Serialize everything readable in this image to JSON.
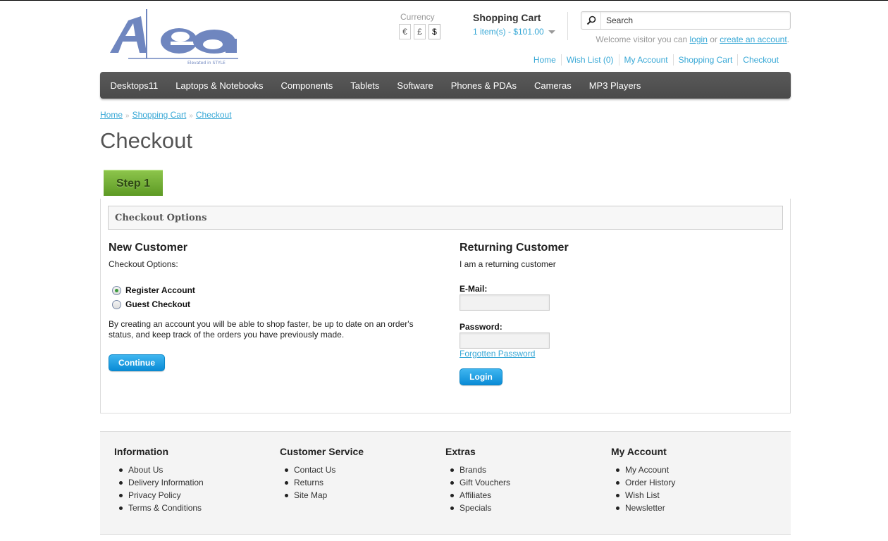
{
  "logo": {
    "letters": "Aea",
    "tagline": "Elevated in STYLE"
  },
  "currency": {
    "label": "Currency",
    "options": [
      "€",
      "£",
      "$"
    ],
    "selected": "$"
  },
  "cart": {
    "title": "Shopping Cart",
    "summary": "1 item(s) - $101.00"
  },
  "search": {
    "placeholder": "Search"
  },
  "welcome": {
    "prefix": "Welcome visitor you can ",
    "login": "login",
    "middle": " or ",
    "create": "create an account",
    "suffix": "."
  },
  "toplinks": [
    "Home",
    "Wish List (0)",
    "My Account",
    "Shopping Cart",
    "Checkout"
  ],
  "menu": [
    "Desktops11",
    "Laptops & Notebooks",
    "Components",
    "Tablets",
    "Software",
    "Phones & PDAs",
    "Cameras",
    "MP3 Players"
  ],
  "breadcrumb": [
    "Home",
    "Shopping Cart",
    "Checkout"
  ],
  "breadcrumb_sep": "»",
  "page_title": "Checkout",
  "step": "Step 1",
  "checkout_options": {
    "heading": "Checkout Options",
    "new_customer": {
      "title": "New Customer",
      "subtitle": "Checkout Options:",
      "options": [
        {
          "label": "Register Account",
          "checked": true
        },
        {
          "label": "Guest Checkout",
          "checked": false
        }
      ],
      "description": "By creating an account you will be able to shop faster, be up to date on an order's status, and keep track of the orders you have previously made.",
      "button": "Continue"
    },
    "returning_customer": {
      "title": "Returning Customer",
      "subtitle": "I am a returning customer",
      "email_label": "E-Mail:",
      "email_value": "",
      "password_label": "Password:",
      "password_value": "",
      "forgot": "Forgotten Password",
      "button": "Login"
    }
  },
  "footer": [
    {
      "title": "Information",
      "items": [
        "About Us",
        "Delivery Information",
        "Privacy Policy",
        "Terms & Conditions"
      ]
    },
    {
      "title": "Customer Service",
      "items": [
        "Contact Us",
        "Returns",
        "Site Map"
      ]
    },
    {
      "title": "Extras",
      "items": [
        "Brands",
        "Gift Vouchers",
        "Affiliates",
        "Specials"
      ]
    },
    {
      "title": "My Account",
      "items": [
        "My Account",
        "Order History",
        "Wish List",
        "Newsletter"
      ]
    }
  ],
  "colors": {
    "accent": "#38a8d6",
    "menu_bg": "#4f4f4f",
    "step_green": "#6aaa2e",
    "logo_blue": "#6f86bf"
  },
  "icons": {
    "search": "magnifier-icon",
    "cart_caret": "chevron-down-icon"
  }
}
